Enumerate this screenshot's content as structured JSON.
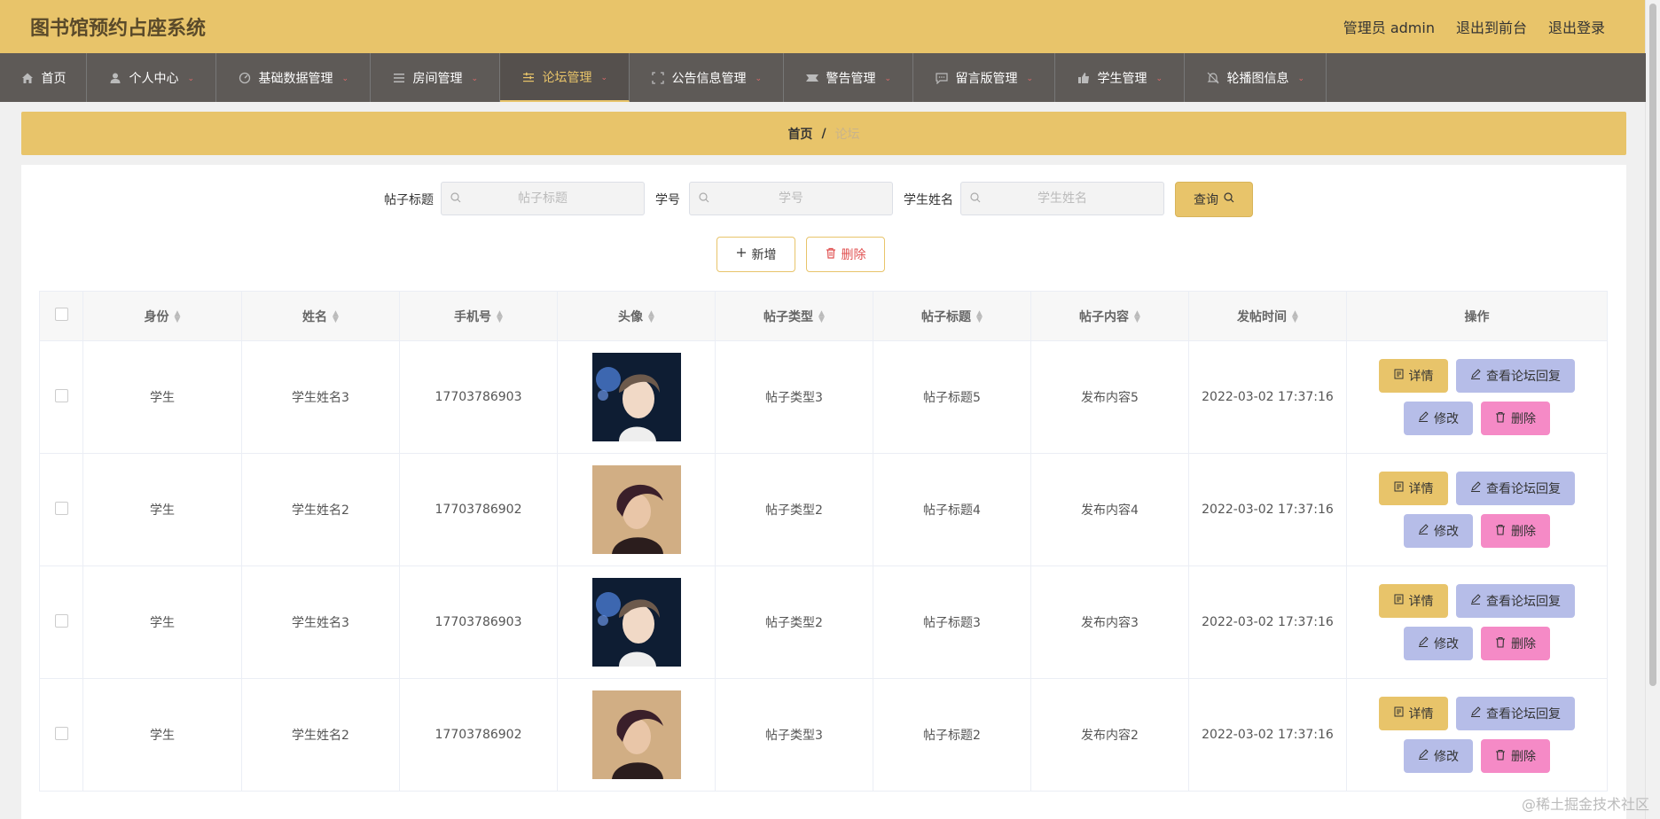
{
  "header": {
    "title": "图书馆预约占座系统",
    "user": "管理员 admin",
    "to_front": "退出到前台",
    "logout": "退出登录"
  },
  "nav": {
    "items": [
      {
        "label": "首页",
        "icon": "home-icon",
        "has_caret": false
      },
      {
        "label": "个人中心",
        "icon": "user-icon",
        "has_caret": true
      },
      {
        "label": "基础数据管理",
        "icon": "dashboard-icon",
        "has_caret": true
      },
      {
        "label": "房间管理",
        "icon": "list-icon",
        "has_caret": true
      },
      {
        "label": "论坛管理",
        "icon": "sliders-icon",
        "has_caret": true,
        "active": true
      },
      {
        "label": "公告信息管理",
        "icon": "fullscreen-icon",
        "has_caret": true
      },
      {
        "label": "警告管理",
        "icon": "ticket-icon",
        "has_caret": true
      },
      {
        "label": "留言版管理",
        "icon": "chat-icon",
        "has_caret": true
      },
      {
        "label": "学生管理",
        "icon": "thumb-icon",
        "has_caret": true
      },
      {
        "label": "轮播图信息",
        "icon": "bell-off-icon",
        "has_caret": true
      }
    ]
  },
  "breadcrumb": {
    "home": "首页",
    "sep": "/",
    "current": "论坛"
  },
  "search": {
    "title_label": "帖子标题",
    "title_placeholder": "帖子标题",
    "id_label": "学号",
    "id_placeholder": "学号",
    "name_label": "学生姓名",
    "name_placeholder": "学生姓名",
    "query_label": "查询"
  },
  "actions": {
    "add_label": "新增",
    "delete_label": "删除"
  },
  "table": {
    "columns": [
      "身份",
      "姓名",
      "手机号",
      "头像",
      "帖子类型",
      "帖子标题",
      "帖子内容",
      "发帖时间",
      "操作"
    ],
    "rows": [
      {
        "role": "学生",
        "name": "学生姓名3",
        "phone": "17703786903",
        "avatar": "avatar-a",
        "type": "帖子类型3",
        "title": "帖子标题5",
        "content": "发布内容5",
        "time": "2022-03-02 17:37:16"
      },
      {
        "role": "学生",
        "name": "学生姓名2",
        "phone": "17703786902",
        "avatar": "avatar-b",
        "type": "帖子类型2",
        "title": "帖子标题4",
        "content": "发布内容4",
        "time": "2022-03-02 17:37:16"
      },
      {
        "role": "学生",
        "name": "学生姓名3",
        "phone": "17703786903",
        "avatar": "avatar-a",
        "type": "帖子类型2",
        "title": "帖子标题3",
        "content": "发布内容3",
        "time": "2022-03-02 17:37:16"
      },
      {
        "role": "学生",
        "name": "学生姓名2",
        "phone": "17703786902",
        "avatar": "avatar-b",
        "type": "帖子类型3",
        "title": "帖子标题2",
        "content": "发布内容2",
        "time": "2022-03-02 17:37:16"
      }
    ],
    "ops": {
      "detail": "详情",
      "reply": "查看论坛回复",
      "edit": "修改",
      "remove": "删除"
    }
  },
  "watermark": "@稀土掘金技术社区",
  "colors": {
    "primary": "#e8c46a",
    "nav_bg": "#5e5a57",
    "reply_btn": "#b6bde8",
    "delete_btn": "#f58ac6"
  }
}
